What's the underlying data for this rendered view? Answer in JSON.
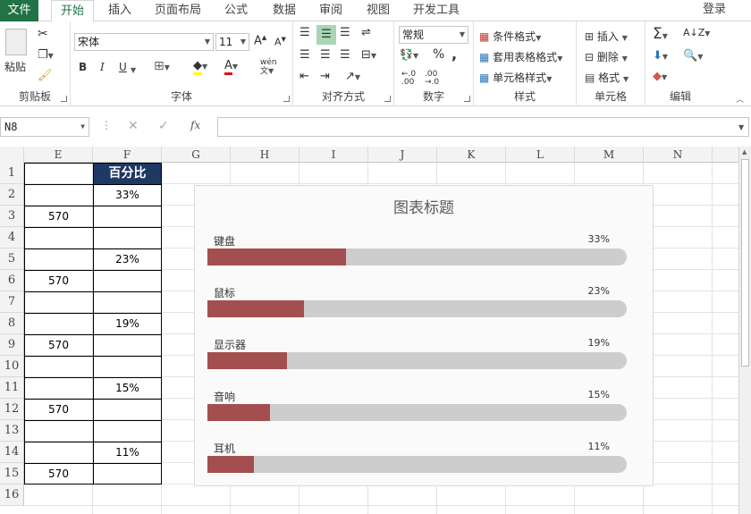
{
  "tabs": [
    "文件",
    "开始",
    "插入",
    "页面布局",
    "公式",
    "数据",
    "审阅",
    "视图",
    "开发工具"
  ],
  "login_label": "登录",
  "ribbon": {
    "clipboard": {
      "label": "剪贴板",
      "paste": "粘贴"
    },
    "font": {
      "label": "字体",
      "name": "宋体",
      "size": "11",
      "bold": "B",
      "italic": "I",
      "underline": "U",
      "phonetic": "wén"
    },
    "alignment": {
      "label": "对齐方式"
    },
    "number": {
      "label": "数字",
      "format": "常规",
      "percent": "%",
      "comma": ","
    },
    "styles": {
      "label": "样式",
      "conditional": "条件格式",
      "table_format": "套用表格格式",
      "cell_styles": "单元格样式"
    },
    "cells": {
      "label": "单元格",
      "insert": "插入",
      "delete": "删除",
      "format": "格式"
    },
    "editing": {
      "label": "编辑"
    }
  },
  "formula_bar": {
    "name_box": "N8",
    "fx": "fx",
    "formula": ""
  },
  "columns": [
    "E",
    "F",
    "G",
    "H",
    "I",
    "J",
    "K",
    "L",
    "M",
    "N"
  ],
  "rows": [
    "1",
    "2",
    "3",
    "4",
    "5",
    "6",
    "7",
    "8",
    "9",
    "10",
    "11",
    "12",
    "13",
    "14",
    "15",
    "16"
  ],
  "table": {
    "header": "百分比",
    "e_values": [
      "570",
      "570",
      "570",
      "570",
      "570"
    ],
    "f_values": [
      "33%",
      "23%",
      "19%",
      "15%",
      "11%"
    ]
  },
  "chart_data": {
    "type": "bar",
    "title": "图表标题",
    "categories": [
      "键盘",
      "鼠标",
      "显示器",
      "音响",
      "耳机"
    ],
    "values": [
      0.33,
      0.23,
      0.19,
      0.15,
      0.11
    ],
    "value_labels": [
      "33%",
      "23%",
      "19%",
      "15%",
      "11%"
    ],
    "xlim": [
      0,
      1
    ],
    "colors": {
      "fill": "#a44f4f",
      "track": "#cdcdcd",
      "header_bg": "#1f3864"
    }
  }
}
